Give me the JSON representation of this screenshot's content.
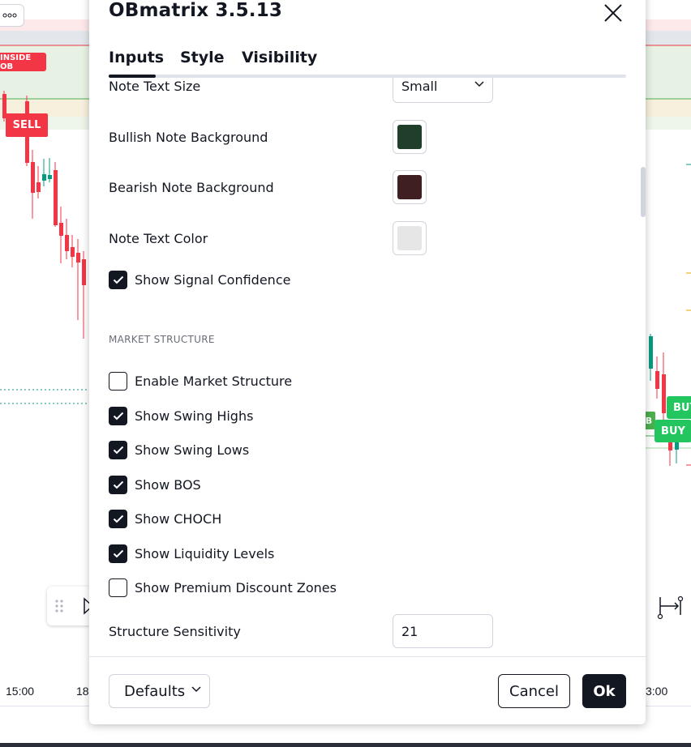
{
  "chart": {
    "labels": {
      "inside_ob": "INSIDE OB",
      "sell": "SELL",
      "buy_top": "BUY",
      "buy_bottom": "BUY",
      "b_marker": "B"
    },
    "time_axis": [
      "15:00",
      "18",
      "3:00"
    ]
  },
  "dialog": {
    "title": "OBmatrix 3.5.13",
    "tabs": [
      {
        "label": "Inputs",
        "active": true
      },
      {
        "label": "Style",
        "active": false
      },
      {
        "label": "Visibility",
        "active": false
      }
    ],
    "settings": {
      "note_text_size": {
        "label": "Note Text Size",
        "value": "Small"
      },
      "bullish_note_bg": {
        "label": "Bullish Note Background",
        "color": "#1f3f2b"
      },
      "bearish_note_bg": {
        "label": "Bearish Note Background",
        "color": "#3f1f22"
      },
      "note_text_color": {
        "label": "Note Text Color",
        "color": "#e6e6e6"
      },
      "show_signal_confidence": {
        "label": "Show Signal Confidence",
        "checked": true
      }
    },
    "market_structure": {
      "section_title": "MARKET STRUCTURE",
      "options": [
        {
          "label": "Enable Market Structure",
          "checked": false
        },
        {
          "label": "Show Swing Highs",
          "checked": true
        },
        {
          "label": "Show Swing Lows",
          "checked": true
        },
        {
          "label": "Show BOS",
          "checked": true
        },
        {
          "label": "Show CHOCH",
          "checked": true
        },
        {
          "label": "Show Liquidity Levels",
          "checked": true
        },
        {
          "label": "Show Premium Discount Zones",
          "checked": false
        }
      ],
      "structure_sensitivity": {
        "label": "Structure Sensitivity",
        "value": "21"
      }
    },
    "footer": {
      "defaults_label": "Defaults",
      "cancel_label": "Cancel",
      "ok_label": "Ok"
    }
  },
  "colors": {
    "bull": "#089981",
    "bear": "#f23645",
    "buy_label": "#22c55e",
    "dark": "#131722"
  }
}
